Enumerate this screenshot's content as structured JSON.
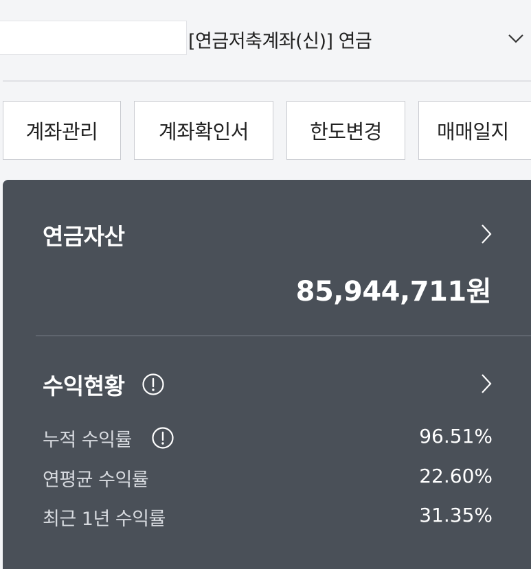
{
  "account": {
    "number": "",
    "name": "[연금저축계좌(신)] 연금"
  },
  "buttons": {
    "account_management": "계좌관리",
    "account_certificate": "계좌확인서",
    "limit_change": "한도변경",
    "trading_journal": "매매일지"
  },
  "pension_assets": {
    "title": "연금자산",
    "total": "85,944,711원"
  },
  "profit_status": {
    "title": "수익현황",
    "rows": [
      {
        "label": "누적 수익률",
        "value": "96.51%"
      },
      {
        "label": "연평균 수익률",
        "value": "22.60%"
      },
      {
        "label": "최근 1년 수익률",
        "value": "31.35%"
      }
    ]
  },
  "colors": {
    "card_background": "#4a5058",
    "page_background": "#f4f5f7"
  }
}
